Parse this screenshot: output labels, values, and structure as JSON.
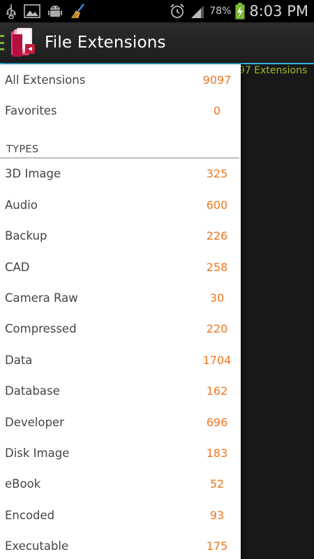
{
  "status_bar": {
    "battery_percent": "78%",
    "time": "8:03 PM",
    "icons": [
      "usb-icon",
      "image-icon",
      "android-icon",
      "broom-icon",
      "alarm-icon",
      "signal-icon",
      "battery-charging-icon"
    ]
  },
  "action_bar": {
    "title": "File Extensions"
  },
  "background": {
    "extension_count_text": "97 Extensions"
  },
  "drawer": {
    "top_items": [
      {
        "label": "All Extensions",
        "count": "9097"
      },
      {
        "label": "Favorites",
        "count": "0"
      }
    ],
    "types_header": "TYPES",
    "types": [
      {
        "label": "3D Image",
        "count": "325"
      },
      {
        "label": "Audio",
        "count": "600"
      },
      {
        "label": "Backup",
        "count": "226"
      },
      {
        "label": "CAD",
        "count": "258"
      },
      {
        "label": "Camera Raw",
        "count": "30"
      },
      {
        "label": "Compressed",
        "count": "220"
      },
      {
        "label": "Data",
        "count": "1704"
      },
      {
        "label": "Database",
        "count": "162"
      },
      {
        "label": "Developer",
        "count": "696"
      },
      {
        "label": "Disk Image",
        "count": "183"
      },
      {
        "label": "eBook",
        "count": "52"
      },
      {
        "label": "Encoded",
        "count": "93"
      },
      {
        "label": "Executable",
        "count": "175"
      }
    ]
  },
  "colors": {
    "accent_blue": "#33b5e5",
    "count_orange": "#f0761e",
    "peek_text_green": "#a7b92a"
  }
}
